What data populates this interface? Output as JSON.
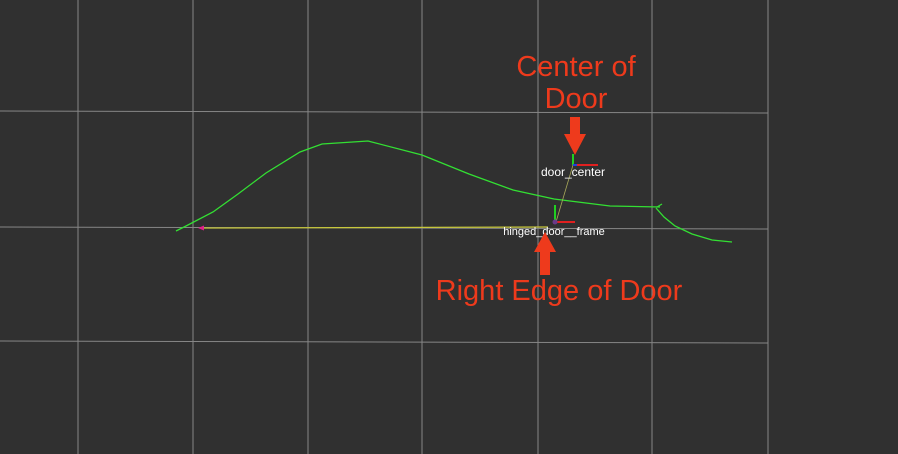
{
  "view": {
    "background_color": "#303030",
    "grid_color": "#a0a0a0"
  },
  "frames": {
    "door_center": "door_center",
    "hinged_door_frame": "hinged_door__frame"
  },
  "annotations": {
    "center_line1": "Center of",
    "center_line2": "Door",
    "right_edge": "Right Edge of Door",
    "color": "#ee3a1c"
  },
  "colors": {
    "laser_path": "#33e033",
    "yellow_line": "#c8c83c",
    "axis_x": "#e02020",
    "axis_y": "#20d020",
    "axis_z": "#2040e0"
  }
}
